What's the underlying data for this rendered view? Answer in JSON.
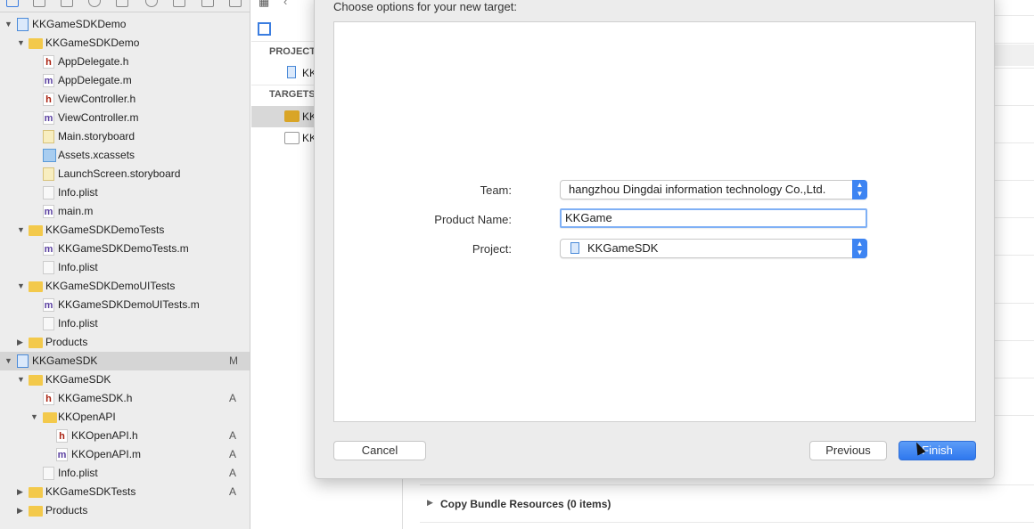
{
  "navigator": {
    "items": [
      {
        "label": "KKGameSDKDemo",
        "icon": "project",
        "level": 0,
        "arrow": "down"
      },
      {
        "label": "KKGameSDKDemo",
        "icon": "folder",
        "level": 1,
        "arrow": "down"
      },
      {
        "label": "AppDelegate.h",
        "icon": "h",
        "level": 2
      },
      {
        "label": "AppDelegate.m",
        "icon": "m",
        "level": 2
      },
      {
        "label": "ViewController.h",
        "icon": "h",
        "level": 2
      },
      {
        "label": "ViewController.m",
        "icon": "m",
        "level": 2
      },
      {
        "label": "Main.storyboard",
        "icon": "sb",
        "level": 2
      },
      {
        "label": "Assets.xcassets",
        "icon": "asset",
        "level": 2
      },
      {
        "label": "LaunchScreen.storyboard",
        "icon": "sb",
        "level": 2
      },
      {
        "label": "Info.plist",
        "icon": "plist",
        "level": 2
      },
      {
        "label": "main.m",
        "icon": "m",
        "level": 2
      },
      {
        "label": "KKGameSDKDemoTests",
        "icon": "folder",
        "level": 1,
        "arrow": "down"
      },
      {
        "label": "KKGameSDKDemoTests.m",
        "icon": "m",
        "level": 2
      },
      {
        "label": "Info.plist",
        "icon": "plist",
        "level": 2
      },
      {
        "label": "KKGameSDKDemoUITests",
        "icon": "folder",
        "level": 1,
        "arrow": "down"
      },
      {
        "label": "KKGameSDKDemoUITests.m",
        "icon": "m",
        "level": 2
      },
      {
        "label": "Info.plist",
        "icon": "plist",
        "level": 2
      },
      {
        "label": "Products",
        "icon": "folder",
        "level": 1,
        "arrow": "right"
      },
      {
        "label": "KKGameSDK",
        "icon": "project",
        "level": 0,
        "arrow": "down",
        "badge": "M",
        "selected": true
      },
      {
        "label": "KKGameSDK",
        "icon": "folder",
        "level": 1,
        "arrow": "down"
      },
      {
        "label": "KKGameSDK.h",
        "icon": "h",
        "level": 2,
        "badge": "A"
      },
      {
        "label": "KKOpenAPI",
        "icon": "folder",
        "level": 2,
        "arrow": "down"
      },
      {
        "label": "KKOpenAPI.h",
        "icon": "h",
        "level": 3,
        "badge": "A"
      },
      {
        "label": "KKOpenAPI.m",
        "icon": "m",
        "level": 3,
        "badge": "A"
      },
      {
        "label": "Info.plist",
        "icon": "plist",
        "level": 2,
        "badge": "A"
      },
      {
        "label": "KKGameSDKTests",
        "icon": "folder",
        "level": 1,
        "arrow": "right",
        "badge": "A"
      },
      {
        "label": "Products",
        "icon": "folder",
        "level": 1,
        "arrow": "right"
      }
    ]
  },
  "middle": {
    "project_header": "PROJECT",
    "project_item": "KK",
    "targets_header": "TARGETS",
    "targets": [
      "KK",
      "KK"
    ]
  },
  "dialog": {
    "title": "Choose options for your new target:",
    "team_label": "Team:",
    "team_value": "hangzhou Dingdai information technology Co.,Ltd.",
    "product_label": "Product Name:",
    "product_value": "KKGame",
    "project_label": "Project:",
    "project_value": "KKGameSDK",
    "cancel": "Cancel",
    "previous": "Previous",
    "finish": "Finish"
  },
  "editor": {
    "section": "Copy Bundle Resources (0 items)"
  },
  "colors": {
    "accent": "#3d84f2",
    "folder": "#f3c94b",
    "selected_row": "#d5d5d5"
  }
}
